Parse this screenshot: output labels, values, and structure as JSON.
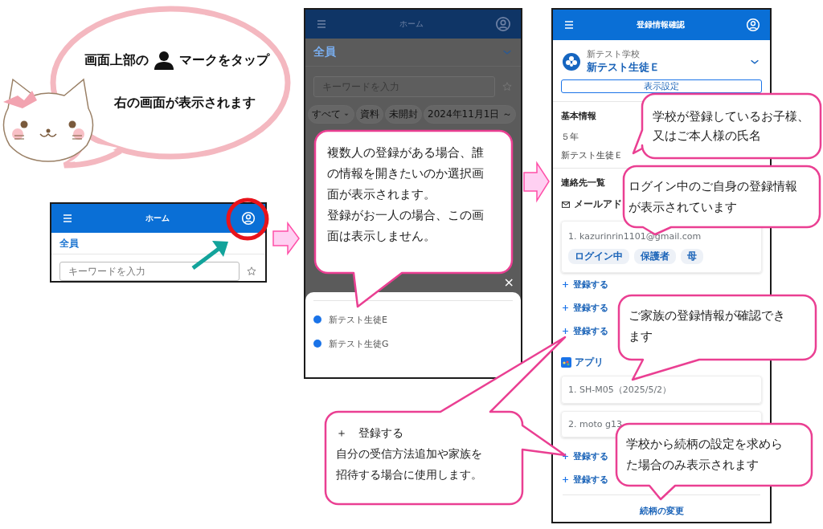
{
  "intro": {
    "text_before_icon": "画面上部の",
    "text_after_icon": "マークをタップ",
    "second_line": "右の画面が表示されます"
  },
  "home_screen": {
    "title": "ホーム",
    "filter": "全員",
    "search_placeholder": "キーワードを入力"
  },
  "selection_screen": {
    "title": "ホーム",
    "filter": "全員",
    "search_placeholder": "キーワードを入力",
    "chips": [
      {
        "label": "すべて",
        "dropdown": true
      },
      {
        "label": "資料",
        "dropdown": false
      },
      {
        "label": "未開封",
        "dropdown": false
      },
      {
        "label": "2024年11月1日 ～",
        "dropdown": false
      }
    ],
    "close": "×",
    "students": [
      "新テスト生徒E",
      "新テスト生徒G"
    ]
  },
  "registration_screen": {
    "title": "登録情報確認",
    "school": "新テスト学校",
    "student": "新テスト生徒Ｅ",
    "display_settings_button": "表示設定",
    "basic_info": {
      "heading": "基本情報",
      "grade": "５年",
      "name": "新テスト生徒Ｅ"
    },
    "contacts": {
      "heading": "連絡先一覧",
      "email_heading": "メールアド",
      "emails": [
        {
          "address": "1. kazurinrin1101@gmail.com",
          "tags": [
            "ログイン中",
            "保護者",
            "母"
          ]
        }
      ],
      "email_add_links": [
        "登録する",
        "登録する",
        "登録する"
      ],
      "app_heading": "アプリ",
      "apps": [
        "1. SH-M05（2025/5/2）",
        "2. moto g13"
      ],
      "app_add_links": [
        "登録する",
        "登録する"
      ]
    },
    "relationship_link": "続柄の変更"
  },
  "callouts": [
    {
      "paragraphs": [
        "複数人の登録がある場合、誰の情報を開きたいのか選択画面が表示されます。",
        "登録がお一人の場合、この画面は表示しません。"
      ]
    },
    {
      "paragraphs": [
        "学校が登録しているお子様、又はご本人様の氏名"
      ]
    },
    {
      "paragraphs": [
        "ログイン中のご自身の登録情報が表示されています"
      ]
    },
    {
      "paragraphs": [
        "ご家族の登録情報が確認できます"
      ]
    },
    {
      "paragraphs": [
        "＋　登録する",
        "自分の受信方法追加や家族を招待する場合に使用します。"
      ]
    },
    {
      "paragraphs": [
        "学校から続柄の設定を求めらた場合のみ表示されます"
      ]
    }
  ]
}
